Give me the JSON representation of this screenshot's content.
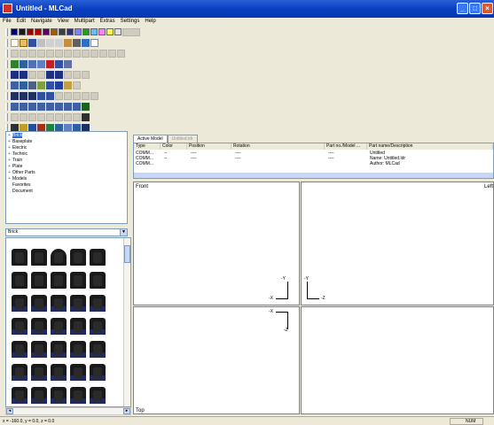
{
  "window": {
    "title": "Untitled - MLCad"
  },
  "menu": [
    "File",
    "Edit",
    "Navigate",
    "View",
    "Multipart",
    "Extras",
    "Settings",
    "Help"
  ],
  "colors": {
    "titlebar": "#0a3fc0",
    "selection": "#316ac5",
    "panel_border": "#7f9db9"
  },
  "palette": [
    "#000080",
    "#1a1a1a",
    "#a00000",
    "#c00000",
    "#600060",
    "#a06000",
    "#404040",
    "#303080",
    "#8080ff",
    "#20a020",
    "#60c0ff",
    "#ff80ff",
    "#ffff40",
    "#e0e0e0"
  ],
  "toolbar_icons": [
    "new-icon",
    "open-icon",
    "save-icon",
    "print-icon",
    "cut-icon",
    "copy-icon",
    "paste-icon",
    "undo-icon",
    "redo-icon",
    "help-icon"
  ],
  "tree": [
    {
      "label": "Brick",
      "expander": "+",
      "selected": true
    },
    {
      "label": "Baseplate",
      "expander": "+"
    },
    {
      "label": "Electric",
      "expander": "+"
    },
    {
      "label": "Technic",
      "expander": "+"
    },
    {
      "label": "Train",
      "expander": "+"
    },
    {
      "label": "Plate",
      "expander": "+"
    },
    {
      "label": "Other Parts",
      "expander": "+"
    },
    {
      "label": "Models",
      "expander": "+"
    },
    {
      "label": "Favorites",
      "expander": ""
    },
    {
      "label": "Document",
      "expander": ""
    }
  ],
  "parts_combo": {
    "value": "Brick"
  },
  "tabs": [
    {
      "label": "Active Model",
      "active": true
    },
    {
      "label": "Untitled.ldr",
      "active": false
    }
  ],
  "list": {
    "headers": [
      "Type",
      "Color",
      "Position",
      "Rotation",
      "Part no./Model ...",
      "Part name/Description"
    ],
    "rows": [
      [
        "COMM...",
        "--",
        "----",
        "----",
        "----",
        "Untitled"
      ],
      [
        "COMM...",
        "--",
        "----",
        "----",
        "----",
        "Name: Untitled.ldr"
      ],
      [
        "COMM...",
        "",
        "",
        "",
        "",
        "Author: MLCad"
      ]
    ]
  },
  "viewports": {
    "front": "Front",
    "left": "Left",
    "top": "Top",
    "axes": {
      "y": "-Y",
      "x": "-X",
      "z": "-Z"
    }
  },
  "status": {
    "coords": "x = -160.0, y = 0.0, z = 0.0",
    "num": "NUM"
  }
}
